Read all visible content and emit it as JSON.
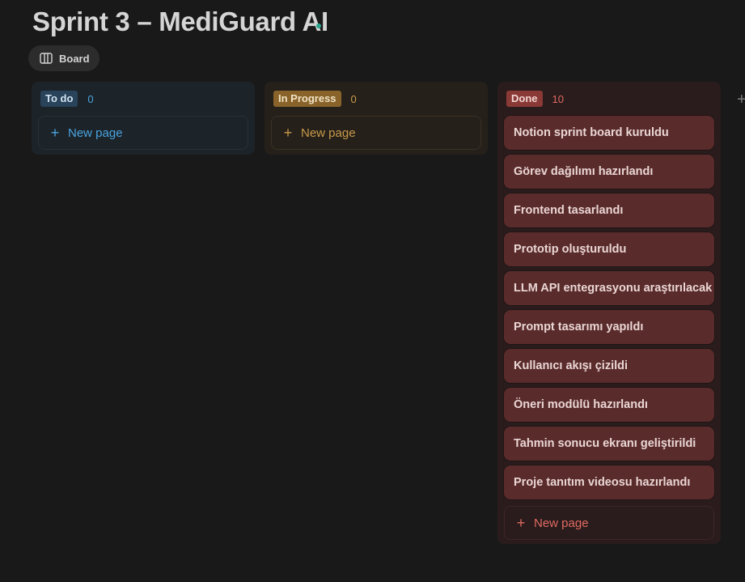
{
  "page": {
    "title": "Sprint 3 – MediGuard AI"
  },
  "view": {
    "label": "Board",
    "icon": "board-columns-icon"
  },
  "columns": {
    "todo": {
      "status": "To do",
      "count": "0",
      "new_page_label": "New page",
      "color": "#28435a"
    },
    "in_progress": {
      "status": "In Progress",
      "count": "0",
      "new_page_label": "New page",
      "color": "#89632a"
    },
    "done": {
      "status": "Done",
      "count": "10",
      "new_page_label": "New page",
      "color": "#8a3a36",
      "cards": [
        "Notion sprint board kuruldu",
        "Görev dağılımı hazırlandı",
        "Frontend tasarlandı",
        "Prototip oluşturuldu",
        "LLM API entegrasyonu araştırılacak",
        "Prompt tasarımı yapıldı",
        "Kullanıcı akışı çizildi",
        "Öneri modülü hazırlandı",
        "Tahmin sonucu ekranı geliştirildi",
        "Proje tanıtım videosu hazırlandı"
      ]
    }
  },
  "add_group_icon": "plus-icon"
}
